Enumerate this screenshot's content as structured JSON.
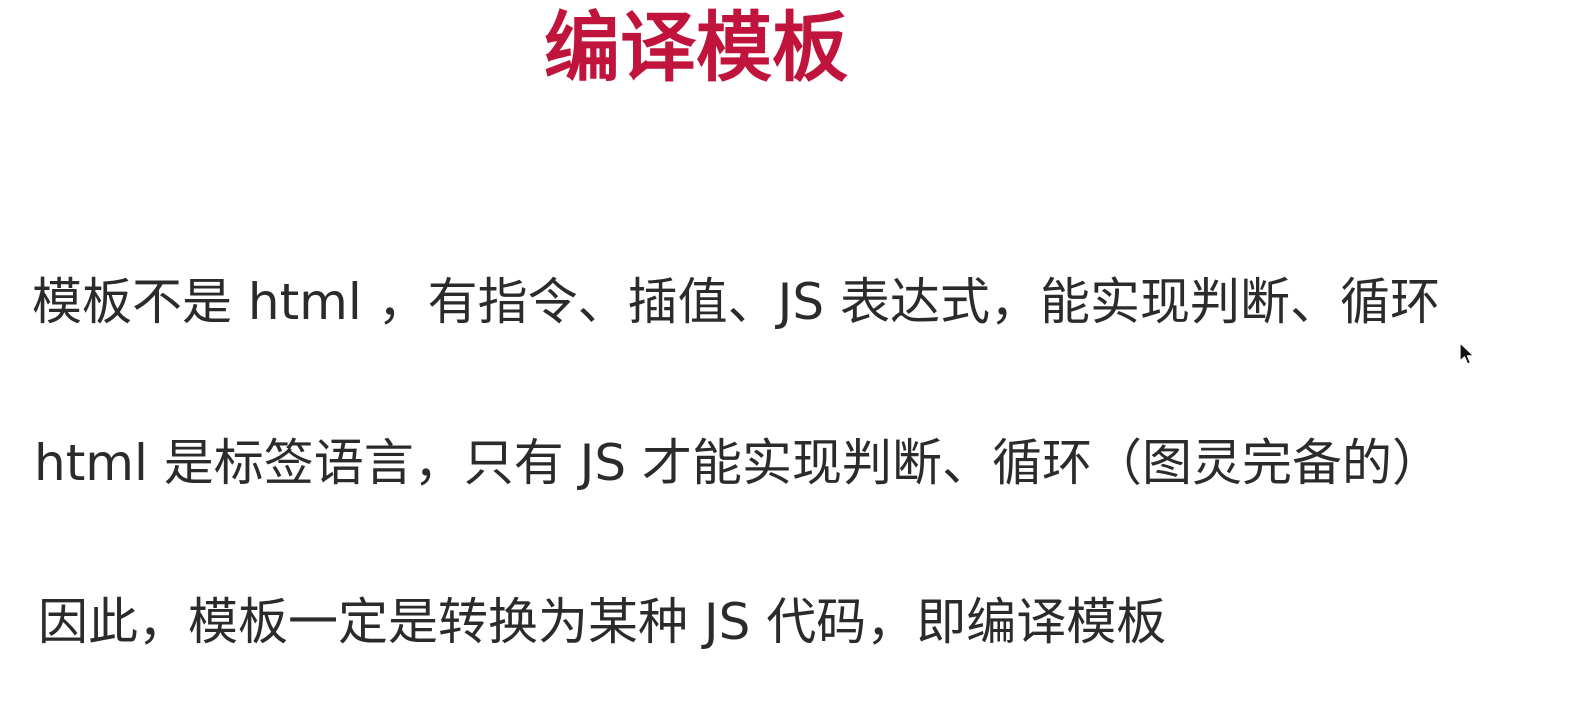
{
  "slide": {
    "title": "编译模板",
    "lines": [
      "模板不是 html ，有指令、插值、JS 表达式，能实现判断、循环",
      "html 是标签语言，只有 JS 才能实现判断、循环（图灵完备的）",
      "因此，模板一定是转换为某种 JS 代码，即编译模板"
    ]
  },
  "colors": {
    "title": "#c0143c",
    "text": "#2b2b2b",
    "background": "#ffffff"
  },
  "icons": {
    "cursor": "mouse-pointer-icon"
  }
}
